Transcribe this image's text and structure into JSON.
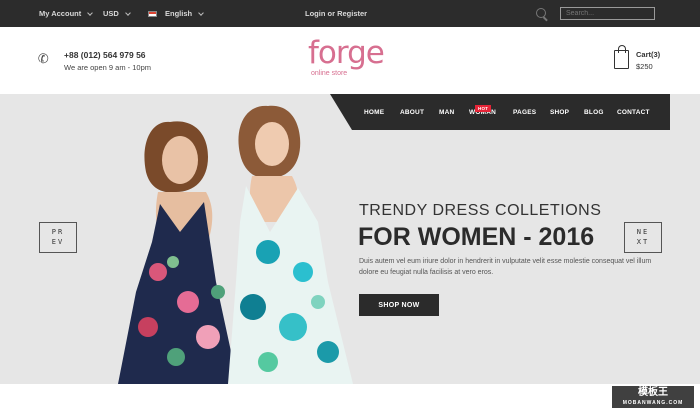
{
  "topbar": {
    "account": "My Account",
    "currency": "USD",
    "language": "English",
    "login": "Login or Register",
    "search_placeholder": "Search..."
  },
  "header": {
    "phone": "+88 (012) 564 979 56",
    "hours": "We are open 9 am - 10pm",
    "logo": "forge",
    "logo_sub": "online store",
    "cart_label": "Cart(3)",
    "cart_total": "$250"
  },
  "nav": {
    "items": [
      "HOME",
      "ABOUT",
      "MAN",
      "WOMAN",
      "PAGES",
      "SHOP",
      "BLOG",
      "CONTACT"
    ],
    "hot_badge": "HOT"
  },
  "hero": {
    "prev_label": "PR\nEV",
    "next_label": "NE\nXT",
    "heading_line1": "TRENDY DRESS COLLETIONS",
    "heading_line2": "FOR WOMEN - 2016",
    "description": "Duis autem vel eum iriure dolor in hendrerit in vulputate velit esse molestie consequat vel illum dolore eu feugiat nulla facilisis at vero eros.",
    "button": "SHOP NOW"
  },
  "watermark": {
    "title": "模板王",
    "sub": "MOBANWANG.COM"
  },
  "colors": {
    "brand": "#d76f90",
    "dark": "#2b2b2b",
    "hot": "#e52437"
  }
}
